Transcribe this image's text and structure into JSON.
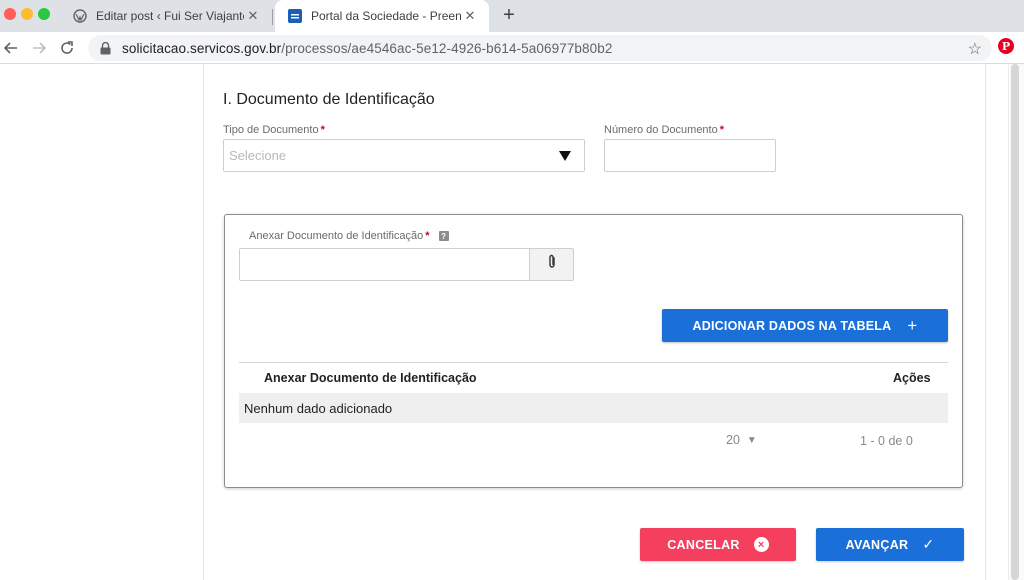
{
  "browser": {
    "tabs": [
      {
        "title": "Editar post ‹ Fui Ser Viajante –",
        "icon": "wordpress-icon",
        "active": false
      },
      {
        "title": "Portal da Sociedade - Preench",
        "icon": "gov-portal-icon",
        "active": true
      }
    ],
    "url_host": "solicitacao.servicos.gov.br",
    "url_path": "/processos/ae4546ac-5e12-4926-b614-5a06977b80b2",
    "extension_letter": "P"
  },
  "form": {
    "section_title": "I. Documento de Identificação",
    "tipo_label": "Tipo de Documento",
    "tipo_placeholder": "Selecione",
    "numero_label": "Número do Documento",
    "required_mark": "*",
    "anexar_label": "Anexar Documento de Identificação",
    "help_mark": "?",
    "add_button": "ADICIONAR DADOS NA TABELA",
    "add_button_icon": "+",
    "table": {
      "columns": [
        "Anexar Documento de Identificação",
        "Ações"
      ],
      "empty_text": "Nenhum dado adicionado",
      "page_size": "20",
      "range": "1 - 0 de 0"
    },
    "cancel_button": "CANCELAR",
    "cancel_icon": "×",
    "next_button": "AVANÇAR",
    "next_icon": "✓"
  },
  "colors": {
    "primary": "#1a6fd9",
    "danger": "#f43f5e",
    "required": "#d9001b"
  }
}
